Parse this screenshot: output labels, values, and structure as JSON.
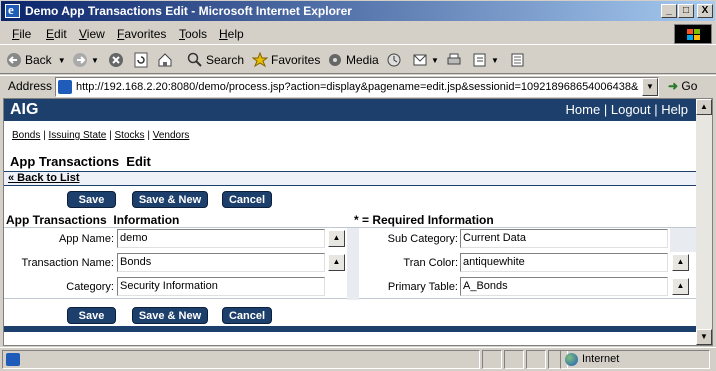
{
  "window": {
    "title": "Demo App Transactions Edit - Microsoft Internet Explorer",
    "minimize": "_",
    "maximize": "□",
    "close": "X"
  },
  "menu": [
    "File",
    "Edit",
    "View",
    "Favorites",
    "Tools",
    "Help"
  ],
  "toolbar": {
    "back": "Back",
    "search": "Search",
    "favorites": "Favorites",
    "media": "Media"
  },
  "address": {
    "label": "Address",
    "url": "http://192.168.2.20:8080/demo/process.jsp?action=display&pagename=edit.jsp&sessionid=109218968654006438&",
    "go": "Go"
  },
  "page": {
    "brand": "AIG",
    "top_links": [
      "Home",
      "Logout",
      "Help"
    ],
    "nav_links": [
      "Bonds",
      "Issuing State",
      "Stocks",
      "Vendors"
    ],
    "title": "App Transactions  Edit",
    "back_link": "« Back to List",
    "buttons": {
      "save": "Save",
      "save_new": "Save & New",
      "cancel": "Cancel"
    },
    "section_title": "App Transactions  Information",
    "required_note": "* = Required Information",
    "fields_left": [
      {
        "label": "App Name:",
        "value": "demo"
      },
      {
        "label": "Transaction Name:",
        "value": "Bonds"
      },
      {
        "label": "Category:",
        "value": "Security Information"
      }
    ],
    "fields_right": [
      {
        "label": "Sub Category:",
        "value": "Current Data"
      },
      {
        "label": "Tran Color:",
        "value": "antiquewhite"
      },
      {
        "label": "Primary Table:",
        "value": "A_Bonds"
      }
    ]
  },
  "status": {
    "zone": "Internet"
  }
}
